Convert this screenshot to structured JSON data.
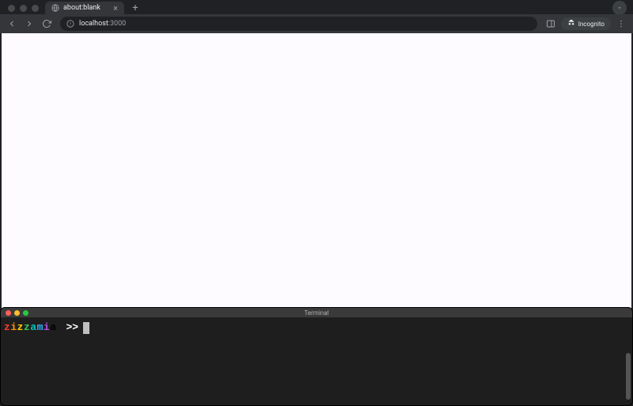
{
  "browser": {
    "tab": {
      "title": "about:blank"
    },
    "omnibox": {
      "host": "localhost",
      "port": ":3000"
    },
    "incognito_label": "Incognito"
  },
  "terminal": {
    "title": "Terminal",
    "user": "zizzamia",
    "prompt": ">>"
  }
}
